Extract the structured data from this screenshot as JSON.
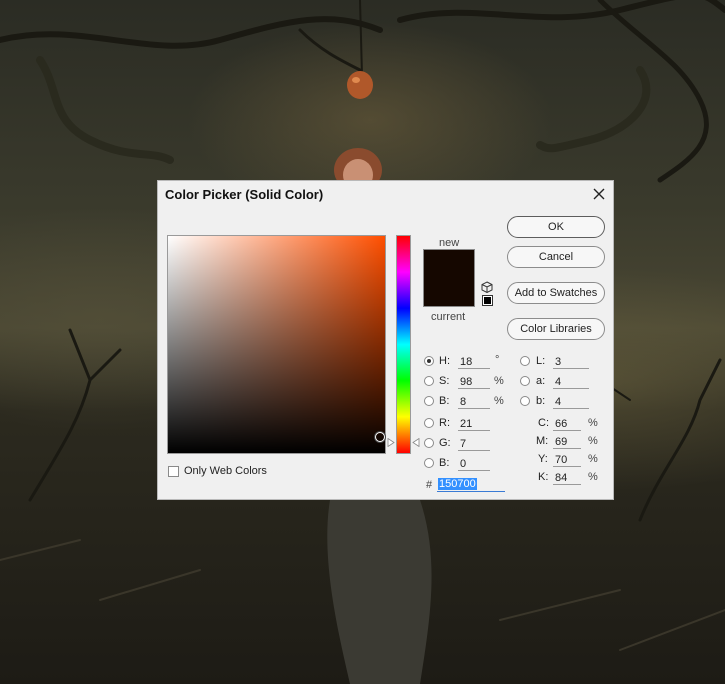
{
  "dialog": {
    "title": "Color Picker (Solid Color)",
    "new_label": "new",
    "current_label": "current",
    "new_color": "#150700",
    "current_color": "#150700",
    "hue_color": "#ff4f00"
  },
  "buttons": {
    "ok": "OK",
    "cancel": "Cancel",
    "add_to_swatches": "Add to Swatches",
    "color_libraries": "Color Libraries"
  },
  "hsb": {
    "h_label": "H:",
    "h_value": "18",
    "h_unit": "°",
    "s_label": "S:",
    "s_value": "98",
    "s_unit": "%",
    "b_label": "B:",
    "b_value": "8",
    "b_unit": "%"
  },
  "rgb": {
    "r_label": "R:",
    "r_value": "21",
    "g_label": "G:",
    "g_value": "7",
    "b_label": "B:",
    "b_value": "0"
  },
  "lab": {
    "l_label": "L:",
    "l_value": "3",
    "a_label": "a:",
    "a_value": "4",
    "b_label": "b:",
    "b_value": "4"
  },
  "cmyk": {
    "c_label": "C:",
    "c_value": "66",
    "c_unit": "%",
    "m_label": "M:",
    "m_value": "69",
    "m_unit": "%",
    "y_label": "Y:",
    "y_value": "70",
    "y_unit": "%",
    "k_label": "K:",
    "k_value": "84",
    "k_unit": "%"
  },
  "hex": {
    "prefix": "#",
    "value": "150700"
  },
  "web_colors": {
    "label": "Only Web Colors",
    "checked": false
  }
}
